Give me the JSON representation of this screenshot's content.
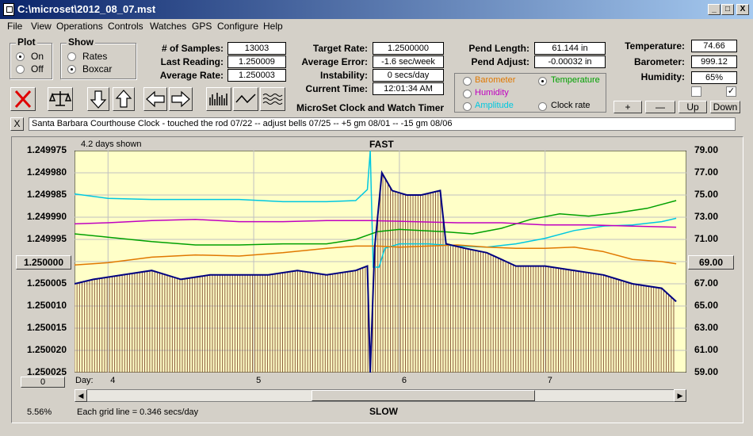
{
  "window": {
    "title": "C:\\microset\\2012_08_07.mst",
    "min": "_",
    "max": "□",
    "close": "X"
  },
  "menu": [
    "File",
    "View",
    "Operations",
    "Controls",
    "Watches",
    "GPS",
    "Configure",
    "Help"
  ],
  "plot": {
    "label": "Plot",
    "options": [
      "On",
      "Off"
    ],
    "selected": "On"
  },
  "show": {
    "label": "Show",
    "options": [
      "Rates",
      "Boxcar"
    ],
    "selected": "Boxcar"
  },
  "stats": {
    "samples_label": "# of Samples:",
    "samples": "13003",
    "last_label": "Last Reading:",
    "last": "1.250009",
    "avg_label": "Average Rate:",
    "avg": "1.250003"
  },
  "rates": {
    "target_label": "Target Rate:",
    "target": "1.2500000",
    "avgerr_label": "Average Error:",
    "avgerr": "-1.6 sec/week",
    "instab_label": "Instability:",
    "instab": "0 secs/day",
    "time_label": "Current Time:",
    "time": "12:01:34 AM"
  },
  "pend": {
    "length_label": "Pend Length:",
    "length": "61.144 in",
    "adjust_label": "Pend Adjust:",
    "adjust": "-0.00032 in"
  },
  "env": {
    "temp_label": "Temperature:",
    "temp": "74.66",
    "baro_label": "Barometer:",
    "baro": "999.12",
    "hum_label": "Humidity:",
    "hum": "65%"
  },
  "sensor_options": [
    {
      "label": "Barometer",
      "color": "#e07800",
      "selected": false
    },
    {
      "label": "Temperature",
      "color": "#00a000",
      "selected": true
    },
    {
      "label": "Humidity",
      "color": "#c000c0",
      "selected": false
    },
    {
      "label": "Clock rate",
      "color": "#000000",
      "selected": false
    },
    {
      "label": "Amplitude",
      "color": "#00c8e0",
      "selected": false
    }
  ],
  "app_title": "MicroSet Clock and Watch Timer",
  "step_buttons": {
    "plus": "+",
    "minus": "—",
    "up": "Up",
    "down": "Down"
  },
  "checkboxes": {
    "left": "",
    "right": "✓"
  },
  "notes_close": "X",
  "notes": "Santa Barbara Courthouse Clock  -  touched the rod 07/22  --  adjust bells 07/25  --  +5 gm 08/01  --  -15 gm 08/06",
  "chart": {
    "days_shown": "4.2 days shown",
    "top_label": "FAST",
    "bottom_label": "SLOW",
    "center_left_button": "1.250000",
    "center_right_button": "69.00",
    "offset_button": "0",
    "zoom": "5.56%",
    "grid_note": "Each grid line = 0.346 secs/day",
    "day_label": "Day:"
  },
  "chart_data": {
    "type": "line",
    "left_axis_ticks": [
      "1.249975",
      "1.249980",
      "1.249985",
      "1.249990",
      "1.249995",
      "1.250000",
      "1.250005",
      "1.250010",
      "1.250015",
      "1.250020",
      "1.250025"
    ],
    "right_axis_ticks": [
      "79.00",
      "77.00",
      "75.00",
      "73.00",
      "71.00",
      "69.00",
      "67.00",
      "65.00",
      "63.00",
      "61.00",
      "59.00"
    ],
    "ylim_left": [
      1.250025,
      1.249975
    ],
    "ylim_right": [
      59,
      79
    ],
    "x_ticks": [
      4,
      5,
      6,
      7
    ],
    "xlim": [
      3.77,
      7.97
    ],
    "grid": true,
    "series": [
      {
        "color": "#00c8e0",
        "x": [
          3.77,
          4.0,
          4.3,
          4.6,
          4.9,
          5.2,
          5.5,
          5.7,
          5.78,
          5.8,
          5.82,
          5.86,
          5.9,
          6.0,
          6.2,
          6.4,
          6.6,
          6.8,
          7.0,
          7.2,
          7.4,
          7.6,
          7.8,
          7.9
        ],
        "y": [
          75.1,
          74.7,
          74.6,
          74.6,
          74.6,
          74.4,
          74.4,
          74.5,
          75.5,
          79.0,
          68.5,
          68.5,
          70.2,
          70.6,
          70.6,
          70.4,
          70.3,
          70.6,
          71.1,
          71.8,
          72.2,
          72.3,
          72.6,
          72.9
        ]
      },
      {
        "color": "#00a000",
        "x": [
          3.77,
          4.0,
          4.3,
          4.6,
          4.9,
          5.2,
          5.5,
          5.7,
          5.85,
          6.0,
          6.3,
          6.5,
          6.7,
          6.9,
          7.1,
          7.3,
          7.5,
          7.7,
          7.9
        ],
        "y": [
          71.5,
          71.2,
          70.8,
          70.5,
          70.5,
          70.6,
          70.6,
          71.0,
          71.7,
          71.9,
          71.7,
          71.5,
          72.0,
          72.8,
          73.3,
          73.1,
          73.4,
          73.8,
          74.5
        ]
      },
      {
        "color": "#c000c0",
        "x": [
          3.77,
          4.0,
          4.3,
          4.6,
          4.9,
          5.2,
          5.5,
          5.8,
          6.1,
          6.4,
          6.7,
          7.0,
          7.3,
          7.6,
          7.9
        ],
        "y": [
          72.4,
          72.5,
          72.7,
          72.8,
          72.6,
          72.6,
          72.7,
          72.7,
          72.6,
          72.5,
          72.5,
          72.3,
          72.3,
          72.2,
          72.1
        ]
      },
      {
        "color": "#e07800",
        "x": [
          3.77,
          4.0,
          4.3,
          4.6,
          4.9,
          5.2,
          5.5,
          5.7,
          5.85,
          6.0,
          6.2,
          6.4,
          6.6,
          6.8,
          7.0,
          7.2,
          7.4,
          7.6,
          7.8,
          7.9
        ],
        "y": [
          68.7,
          68.9,
          69.4,
          69.6,
          69.5,
          69.8,
          70.2,
          70.4,
          70.4,
          70.3,
          70.4,
          70.5,
          70.3,
          70.2,
          70.2,
          70.3,
          69.9,
          69.2,
          69.0,
          68.8
        ]
      },
      {
        "color": "#000080",
        "x": [
          3.77,
          3.9,
          4.1,
          4.3,
          4.5,
          4.7,
          4.9,
          5.1,
          5.3,
          5.5,
          5.7,
          5.78,
          5.8,
          5.83,
          5.88,
          5.95,
          6.05,
          6.15,
          6.28,
          6.32,
          6.45,
          6.6,
          6.8,
          7.0,
          7.2,
          7.4,
          7.6,
          7.8,
          7.9
        ],
        "y": [
          1.250005,
          1.250004,
          1.250003,
          1.250002,
          1.250004,
          1.250003,
          1.250003,
          1.250003,
          1.250002,
          1.250003,
          1.250002,
          1.250001,
          1.250025,
          1.249997,
          1.24998,
          1.249984,
          1.249985,
          1.249985,
          1.249984,
          1.249996,
          1.249997,
          1.249998,
          1.250001,
          1.250001,
          1.250002,
          1.250003,
          1.250005,
          1.250006,
          1.250009
        ]
      }
    ]
  }
}
